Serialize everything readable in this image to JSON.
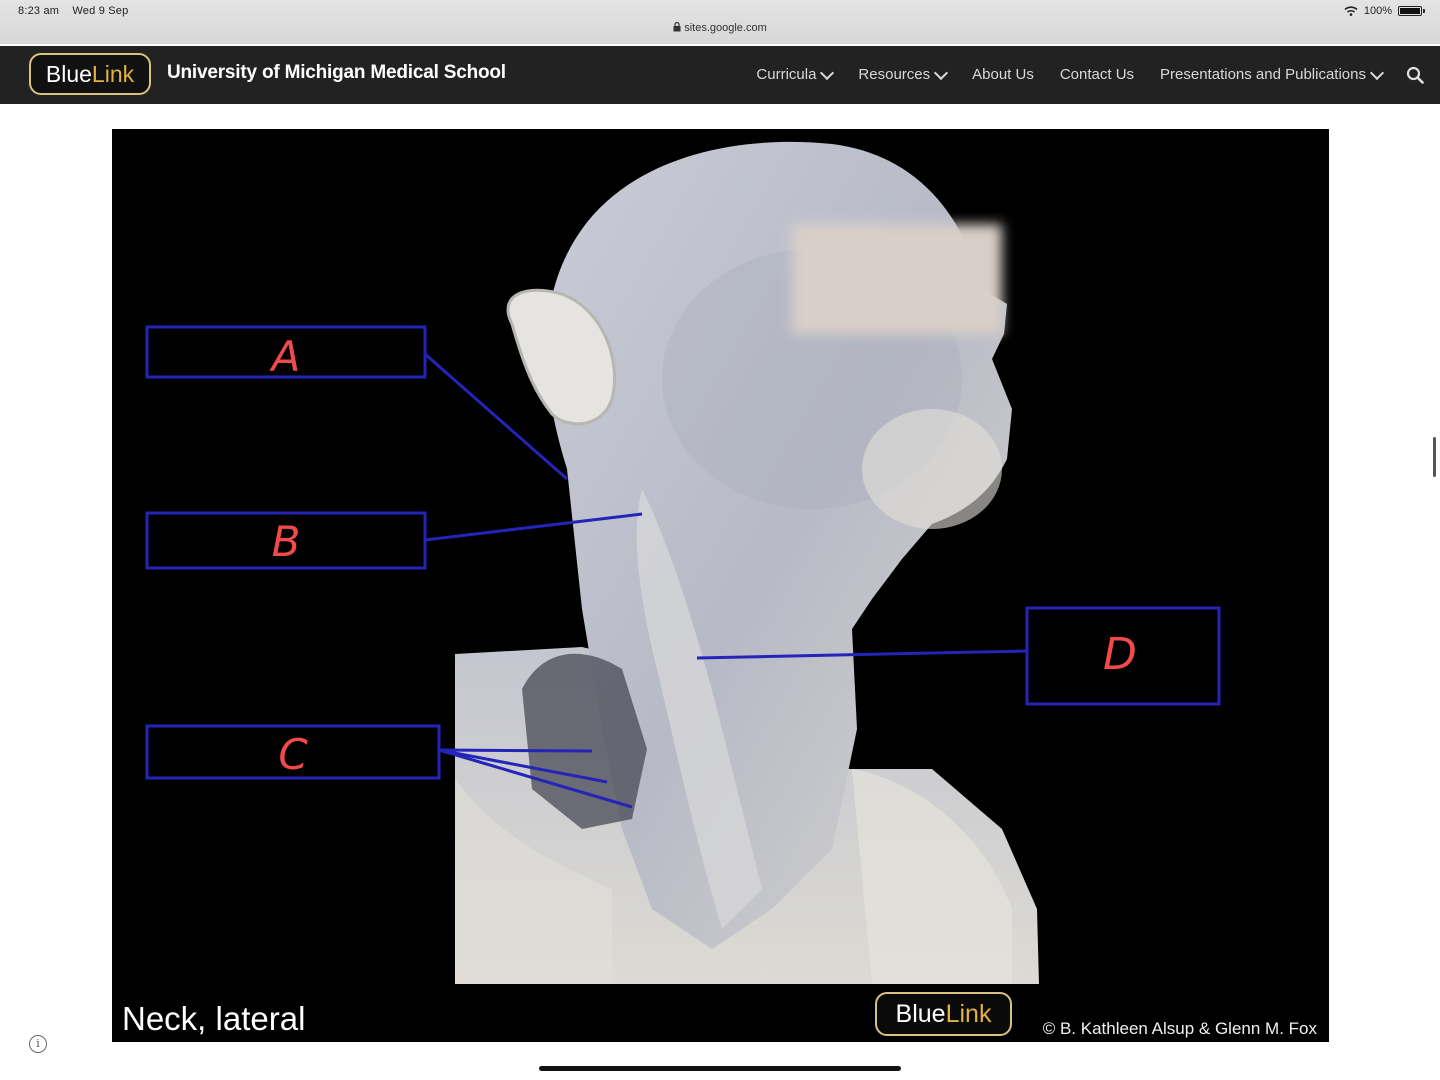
{
  "status_bar": {
    "time": "8:23 am",
    "date": "Wed 9 Sep",
    "url": "sites.google.com",
    "battery": "100%",
    "battery_level": 1.0,
    "icons": [
      "lock-icon",
      "wifi-icon",
      "battery-icon"
    ]
  },
  "site": {
    "logo_blue": "Blue",
    "logo_link": "Link",
    "title": "University of Michigan Medical School",
    "nav": [
      {
        "label": "Curricula",
        "dropdown": true
      },
      {
        "label": "Resources",
        "dropdown": true
      },
      {
        "label": "About Us",
        "dropdown": false
      },
      {
        "label": "Contact Us",
        "dropdown": false
      },
      {
        "label": "Presentations and Publications",
        "dropdown": true
      }
    ],
    "search_icon": "search-icon"
  },
  "figure": {
    "caption": "Neck, lateral",
    "logo_blue": "Blue",
    "logo_link": "Link",
    "credit": "© B. Kathleen Alsup & Glenn M. Fox",
    "labels": [
      "A",
      "B",
      "C",
      "D"
    ],
    "colors": {
      "box": "#2424b8",
      "letter": "#f04a4a",
      "background": "#000000"
    }
  },
  "info_icon": "info-icon"
}
